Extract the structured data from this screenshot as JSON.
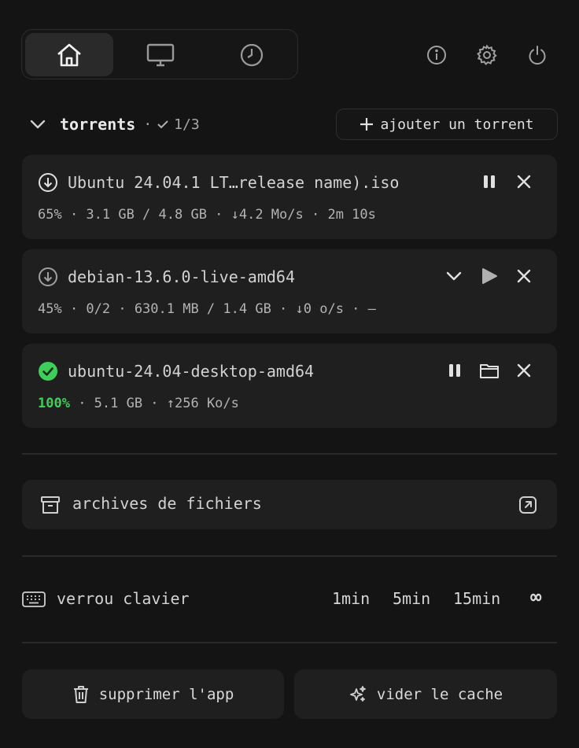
{
  "nav": {
    "tabs": [
      {
        "icon": "home-icon",
        "active": true
      },
      {
        "icon": "monitor-icon",
        "active": false
      },
      {
        "icon": "clock-icon",
        "active": false
      }
    ],
    "right_icons": [
      "info-icon",
      "gear-icon",
      "power-icon"
    ]
  },
  "torrents": {
    "title": "torrents",
    "separator": "·",
    "status": "1/3",
    "add_label": "ajouter un torrent",
    "items": [
      {
        "name": "Ubuntu 24.04.1 LT…release name).iso",
        "status_icon": "download-icon",
        "details": "65% · 3.1 GB / 4.8 GB · ↓4.2 Mo/s · 2m 10s",
        "actions": [
          "pause-icon",
          "close-icon"
        ]
      },
      {
        "name": "debian-13.6.0-live-amd64",
        "status_icon": "download-icon",
        "details": "45% · 0/2 · 630.1 MB / 1.4 GB · ↓0 o/s · —",
        "actions": [
          "chevron-down-icon",
          "play-icon",
          "close-icon"
        ]
      },
      {
        "name": "ubuntu-24.04-desktop-amd64",
        "status_icon": "check-circle-icon",
        "percent": "100%",
        "details_rest": " · 5.1 GB · ↑256 Ko/s",
        "actions": [
          "pause-icon",
          "folder-icon",
          "close-icon"
        ]
      }
    ]
  },
  "archives": {
    "label": "archives de fichiers"
  },
  "keyboard_lock": {
    "label": "verrou clavier",
    "options": [
      "1min",
      "5min",
      "15min",
      "∞"
    ]
  },
  "buttons": {
    "delete_app": "supprimer l'app",
    "clear_cache": "vider le cache"
  },
  "colors": {
    "background": "#141414",
    "card": "#1f1f1f",
    "success": "#3ecf5a"
  }
}
